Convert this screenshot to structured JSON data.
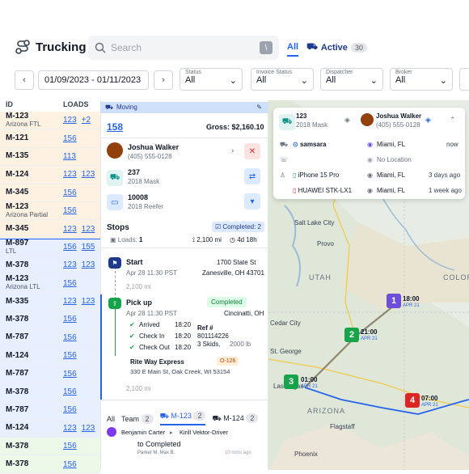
{
  "header": {
    "title": "Trucking",
    "search_placeholder": "Search",
    "search_shortcut": "\\",
    "tabs": [
      {
        "label": "All"
      },
      {
        "label": "Active",
        "count": "30"
      }
    ]
  },
  "filters": {
    "date_range": "01/09/2023 - 01/11/2023",
    "items": [
      {
        "label": "Status",
        "value": "All"
      },
      {
        "label": "Invoice Status",
        "value": "All"
      },
      {
        "label": "Dispatcher",
        "value": "All"
      },
      {
        "label": "Broker",
        "value": "All"
      }
    ]
  },
  "table": {
    "headers": {
      "id": "ID",
      "loads": "LOADS"
    },
    "rows": [
      {
        "id": "M-123",
        "sub": "Arizona FTL",
        "loads": [
          "123",
          "+2"
        ]
      },
      {
        "id": "M-121",
        "sub": "",
        "loads": [
          "156"
        ]
      },
      {
        "id": "M-135",
        "sub": "",
        "loads": [
          "113"
        ]
      },
      {
        "id": "M-124",
        "sub": "",
        "loads": [
          "123",
          "123"
        ]
      },
      {
        "id": "M-345",
        "sub": "",
        "loads": [
          "156"
        ]
      },
      {
        "id": "M-123",
        "sub": "Arizona Partial",
        "loads": [
          "156"
        ]
      },
      {
        "id": "M-345",
        "sub": "",
        "loads": [
          "123",
          "123"
        ]
      },
      {
        "id": "M-897",
        "sub": "LTL",
        "loads": [
          "156",
          "155"
        ]
      },
      {
        "id": "M-378",
        "sub": "",
        "loads": [
          "123",
          "123"
        ]
      },
      {
        "id": "M-123",
        "sub": "Arizona LTL",
        "loads": [
          "156"
        ]
      },
      {
        "id": "M-335",
        "sub": "",
        "loads": [
          "123",
          "123"
        ]
      },
      {
        "id": "M-378",
        "sub": "",
        "loads": [
          "156"
        ]
      },
      {
        "id": "M-787",
        "sub": "",
        "loads": [
          "156"
        ]
      },
      {
        "id": "M-124",
        "sub": "",
        "loads": [
          "156"
        ]
      },
      {
        "id": "M-787",
        "sub": "",
        "loads": [
          "156"
        ]
      },
      {
        "id": "M-378",
        "sub": "",
        "loads": [
          "156"
        ]
      },
      {
        "id": "M-787",
        "sub": "",
        "loads": [
          "156"
        ]
      },
      {
        "id": "M-124",
        "sub": "",
        "loads": [
          "123",
          "123"
        ]
      },
      {
        "id": "M-378",
        "sub": "",
        "loads": [
          "156"
        ]
      },
      {
        "id": "M-378",
        "sub": "",
        "loads": [
          "156"
        ]
      }
    ]
  },
  "detail": {
    "status": "Moving",
    "load_id": "158",
    "gross": "Gross: $2,160.10",
    "driver": {
      "name": "Joshua Walker",
      "phone": "(405) 555-0128"
    },
    "truck": {
      "number": "237",
      "model": "2018 Mask"
    },
    "trailer": {
      "number": "10008",
      "model": "2019 Reefer"
    },
    "stops_title": "Stops",
    "completed_badge": "Completed: 2",
    "loads_label": "Loads:",
    "loads_count": "1",
    "distance": "2,100 mi",
    "duration": "4d 18h",
    "start": {
      "label": "Start",
      "address1": "1700 State St",
      "date": "Apr 28 11:30 PST",
      "address2": "Zanesville, OH 43701"
    },
    "leg_distance": "2,100 mi",
    "pickup": {
      "label": "Pick up",
      "status": "Completed",
      "date": "Apr 28 11:30 PST",
      "city": "Cincinatti, OH",
      "arrived_label": "Arrived",
      "arrived_time": "18:20",
      "checkin_label": "Check In",
      "checkin_time": "18:20",
      "checkout_label": "Check Out",
      "checkout_time": "18:20",
      "ref_label": "Ref #",
      "ref_value": "801114226",
      "skids": "3 Skids,",
      "weight": "2000 lb"
    },
    "shipper": {
      "name": "Rite Way Express",
      "badge": "O-126",
      "address": "330 E Main St, Oak Creek, WI 53154"
    },
    "leg_distance2": "2,100 mi",
    "bottom_tabs": [
      {
        "label": "All",
        "count": ""
      },
      {
        "label": "Team",
        "count": "2"
      },
      {
        "label": "M-123",
        "count": "2"
      },
      {
        "label": "M-124",
        "count": "2"
      }
    ],
    "messages": [
      {
        "from": "Benjamin Carter",
        "to": "Kirill Vektor-Driver",
        "text": "to Completed",
        "time": "10 mins ago",
        "author": "Parker M. Max B."
      }
    ]
  },
  "map_card": {
    "truck": {
      "number": "123",
      "model": "2018 Mask"
    },
    "driver": {
      "name": "Joshua Walker",
      "phone": "(405) 555-0128"
    },
    "rows": [
      {
        "device": "samsara",
        "location": "Miami, FL",
        "time": "now"
      },
      {
        "device": "",
        "location": "No Location",
        "time": ""
      },
      {
        "device": "iPhone 15 Pro",
        "location": "Miami, FL",
        "time": "3 days ago"
      },
      {
        "device": "HUAWEI STK-LX1",
        "location": "Miami, FL",
        "time": "1 week ago"
      }
    ]
  },
  "map": {
    "states": [
      "UTAH",
      "COLOR",
      "ARIZONA"
    ],
    "places": [
      "Salt Lake City",
      "Provo",
      "Cedar City",
      "Las Vegas",
      "Flagstaff",
      "Phoenix",
      "St. George"
    ],
    "markers": [
      {
        "n": "1",
        "time": "18:00",
        "date": "APR 21",
        "color": "#6d4ed8"
      },
      {
        "n": "2",
        "time": "21:00",
        "date": "APR 21",
        "color": "#16a34a"
      },
      {
        "n": "3",
        "time": "01:00",
        "date": "APR 21",
        "color": "#16a34a"
      },
      {
        "n": "4",
        "time": "07:00",
        "date": "APR 21",
        "color": "#dc2626"
      }
    ]
  }
}
